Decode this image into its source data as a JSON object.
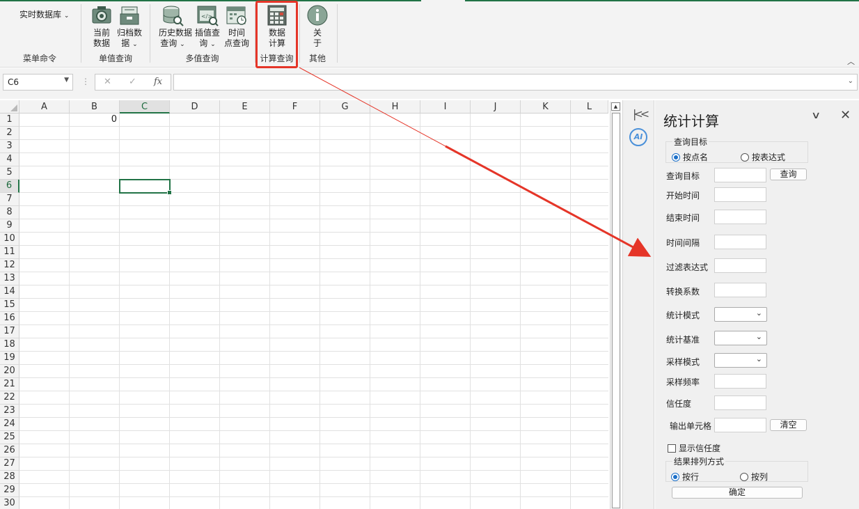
{
  "ribbon": {
    "menu_dropdown": "实时数据库",
    "groups": [
      {
        "label": "菜单命令"
      },
      {
        "label": "单值查询"
      },
      {
        "label": "多值查询"
      },
      {
        "label": "计算查询"
      },
      {
        "label": "其他"
      }
    ],
    "buttons": {
      "current_data": {
        "line1": "当前",
        "line2": "数据"
      },
      "archive_data": {
        "line1": "归档数",
        "line2": "据"
      },
      "history_query": {
        "line1": "历史数据",
        "line2": "查询"
      },
      "interpolation_query": {
        "line1": "插值查",
        "line2": "询"
      },
      "time_point_query": {
        "line1": "时间",
        "line2": "点查询"
      },
      "data_calc": {
        "line1": "数据",
        "line2": "计算"
      },
      "about": {
        "line1": "关",
        "line2": "于"
      }
    },
    "highlight_color": "#e53528"
  },
  "formula_bar": {
    "name_box": "C6",
    "cancel_icon": "✕",
    "enter_icon": "✓",
    "fx_label": "fx",
    "formula": ""
  },
  "sheet": {
    "columns": [
      "A",
      "B",
      "C",
      "D",
      "E",
      "F",
      "G",
      "H",
      "I",
      "J",
      "K",
      "L"
    ],
    "rows": [
      "1",
      "2",
      "3",
      "4",
      "5",
      "6",
      "7",
      "8",
      "9",
      "10",
      "11",
      "12",
      "13",
      "14",
      "15",
      "16",
      "17",
      "18",
      "19",
      "20",
      "21",
      "22",
      "23",
      "24",
      "25",
      "26",
      "27",
      "28",
      "29",
      "30"
    ],
    "active_cell": "C6",
    "cells": [
      {
        "ref": "B1",
        "value": "0"
      }
    ],
    "accent_color": "#217346"
  },
  "pane": {
    "title": "统计计算",
    "query_target_group": {
      "legend": "查询目标",
      "options": [
        "按点名",
        "按表达式"
      ],
      "selected": "按点名"
    },
    "fields": {
      "query_target": {
        "label": "查询目标",
        "value": "",
        "button": "查询"
      },
      "start_time": {
        "label": "开始时间",
        "value": ""
      },
      "end_time": {
        "label": "结束时间",
        "value": ""
      },
      "interval": {
        "label": "时间间隔",
        "value": ""
      },
      "filter_expr": {
        "label": "过滤表达式",
        "value": ""
      },
      "conversion": {
        "label": "转换系数",
        "value": ""
      },
      "stat_mode": {
        "label": "统计模式",
        "value": ""
      },
      "stat_base": {
        "label": "统计基准",
        "value": ""
      },
      "sample_mode": {
        "label": "采样模式",
        "value": ""
      },
      "sample_freq": {
        "label": "采样频率",
        "value": ""
      },
      "confidence": {
        "label": "信任度",
        "value": ""
      },
      "output_cell": {
        "label": "输出单元格",
        "value": "",
        "button": "清空"
      }
    },
    "show_confidence": {
      "label": "显示信任度",
      "checked": false
    },
    "result_order_group": {
      "legend": "结果排列方式",
      "options": [
        "按行",
        "按列"
      ],
      "selected": "按行"
    },
    "confirm_button": "确定"
  }
}
